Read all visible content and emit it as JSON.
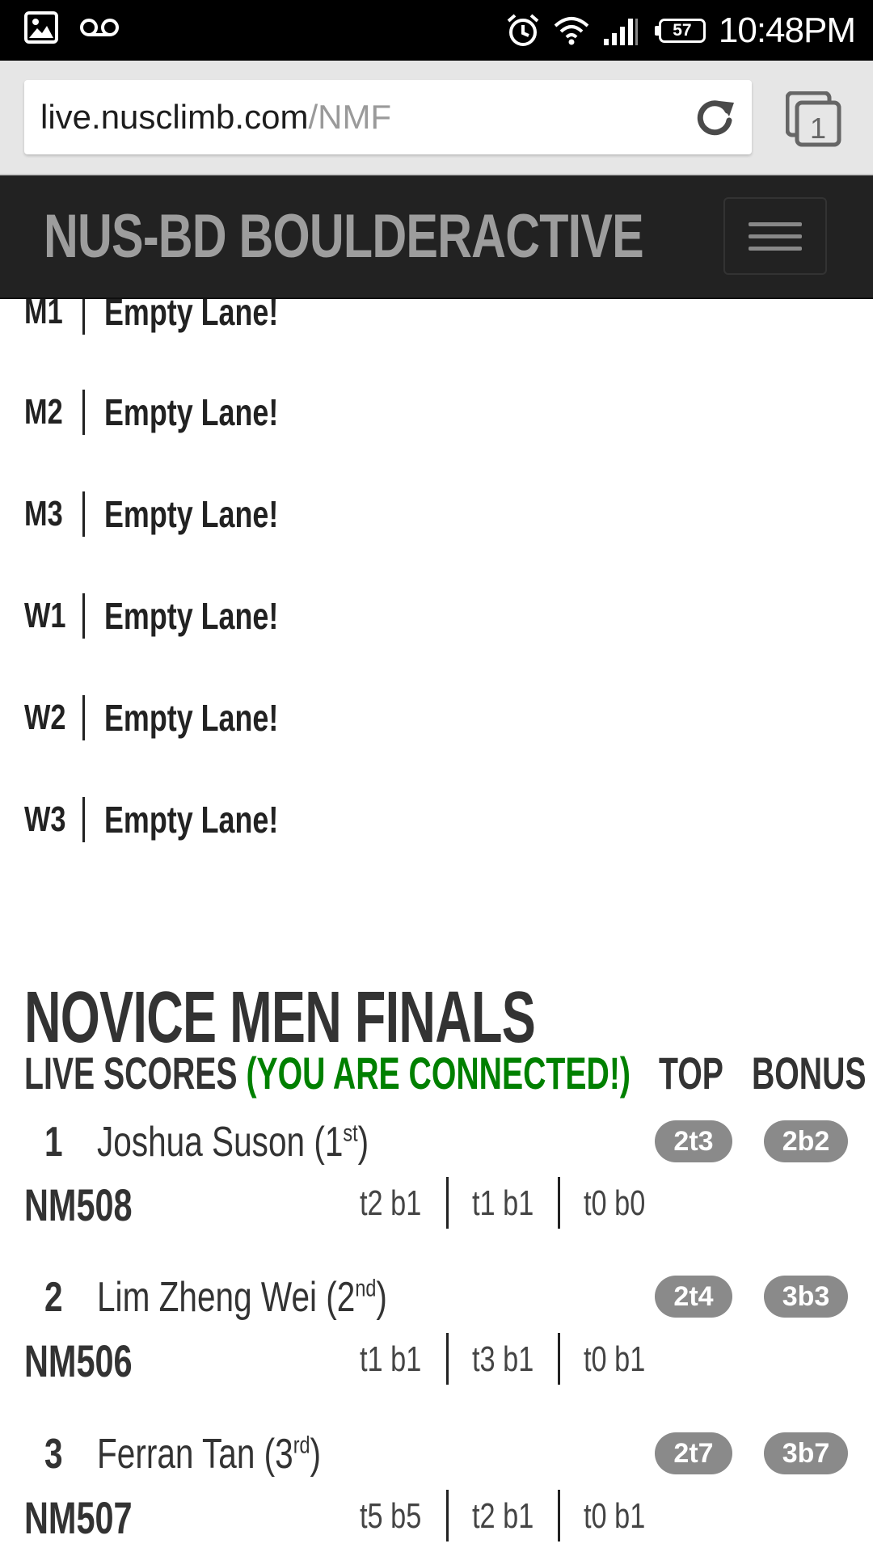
{
  "status_bar": {
    "time": "10:48PM",
    "battery": "57",
    "icons": [
      "image-icon",
      "voicemail-icon",
      "alarm-icon",
      "wifi-icon",
      "signal-icon",
      "battery-icon"
    ]
  },
  "browser": {
    "url_host": "live.nusclimb.com",
    "url_path": "/NMF",
    "tab_count": "1"
  },
  "navbar": {
    "brand": "NUS-BD BOULDERACTIVE"
  },
  "lanes": [
    {
      "code": "M1",
      "status": "Empty Lane!"
    },
    {
      "code": "M2",
      "status": "Empty Lane!"
    },
    {
      "code": "M3",
      "status": "Empty Lane!"
    },
    {
      "code": "W1",
      "status": "Empty Lane!"
    },
    {
      "code": "W2",
      "status": "Empty Lane!"
    },
    {
      "code": "W3",
      "status": "Empty Lane!"
    }
  ],
  "scores": {
    "title": "NOVICE MEN FINALS",
    "subtitle": "LIVE SCORES",
    "connection": "(YOU ARE CONNECTED!)",
    "col_top": "TOP",
    "col_bonus": "BONUS",
    "entries": [
      {
        "rank": "1",
        "name": "Joshua Suson (1",
        "suffix": "st",
        "close": ")",
        "top": "2t3",
        "bonus": "2b2",
        "id": "NM508",
        "attempts": [
          "t2 b1",
          "t1 b1",
          "t0 b0"
        ]
      },
      {
        "rank": "2",
        "name": "Lim Zheng Wei (2",
        "suffix": "nd",
        "close": ")",
        "top": "2t4",
        "bonus": "3b3",
        "id": "NM506",
        "attempts": [
          "t1 b1",
          "t3 b1",
          "t0 b1"
        ]
      },
      {
        "rank": "3",
        "name": "Ferran Tan (3",
        "suffix": "rd",
        "close": ")",
        "top": "2t7",
        "bonus": "3b7",
        "id": "NM507",
        "attempts": [
          "t5 b5",
          "t2 b1",
          "t0 b1"
        ]
      }
    ]
  },
  "colors": {
    "status_bg": "#000000",
    "chrome_bg": "#e6e6e6",
    "navbar_bg": "#222222",
    "brand": "#9d9d9d",
    "connected": "#008000",
    "badge": "#8a8a8a"
  }
}
